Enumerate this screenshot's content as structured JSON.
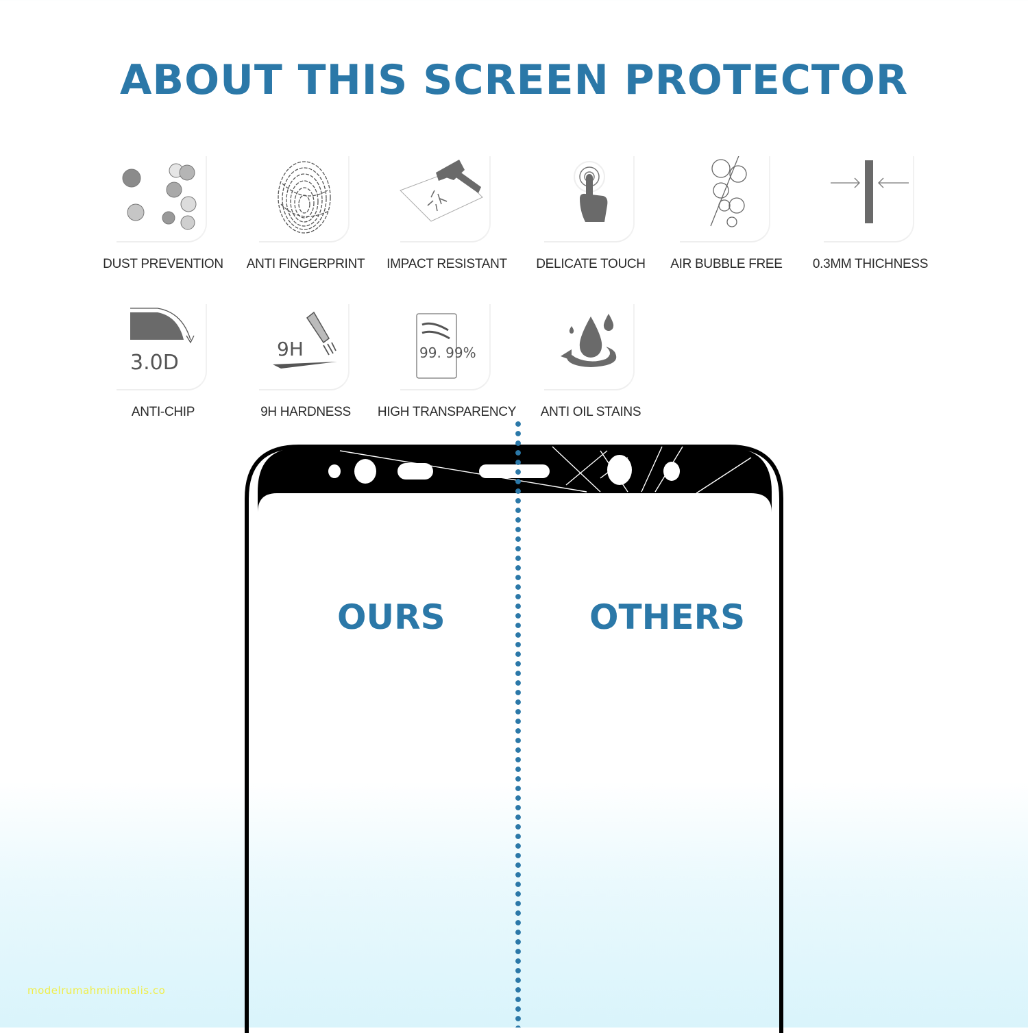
{
  "header": {
    "title": "ABOUT THIS SCREEN PROTECTOR"
  },
  "features": [
    {
      "label": "DUST PREVENTION",
      "icon": "dust-particles-icon"
    },
    {
      "label": "ANTI FINGERPRINT",
      "icon": "fingerprint-icon"
    },
    {
      "label": "IMPACT RESISTANT",
      "icon": "hammer-icon"
    },
    {
      "label": "DELICATE TOUCH",
      "icon": "finger-touch-icon"
    },
    {
      "label": "AIR BUBBLE FREE",
      "icon": "bubbles-icon"
    },
    {
      "label": "0.3MM THICHNESS",
      "icon": "thickness-icon"
    },
    {
      "label": "ANTI-CHIP",
      "icon": "curved-edge-icon",
      "icon_text": "3.0D"
    },
    {
      "label": "9H HARDNESS",
      "icon": "blade-icon",
      "icon_text": "9H"
    },
    {
      "label": "HIGH TRANSPARENCY",
      "icon": "transparency-icon",
      "icon_text": "99. 99%"
    },
    {
      "label": "ANTI OIL STAINS",
      "icon": "oil-drop-icon"
    }
  ],
  "comparison": {
    "left_label": "OURS",
    "right_label": "OTHERS"
  },
  "watermark": "modelrumahminimalis.co",
  "colors": {
    "accent": "#2b78a8",
    "icon_gray": "#6a6a6a",
    "watermark": "#f0ee4a"
  }
}
